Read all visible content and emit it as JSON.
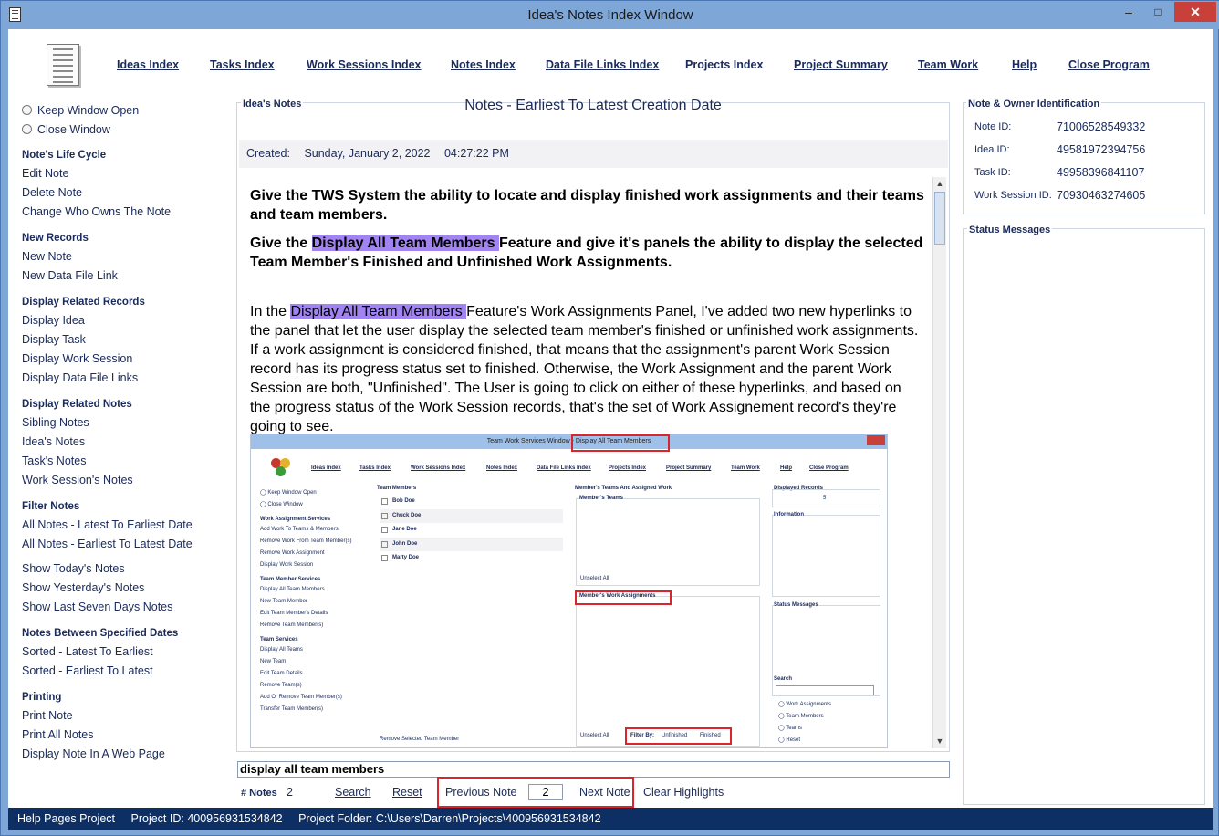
{
  "window": {
    "title": "Idea's Notes Index Window",
    "minimize": "–",
    "maximize": "□",
    "close": "✕"
  },
  "nav": [
    "Ideas Index",
    "Tasks Index",
    "Work Sessions Index",
    "Notes Index",
    "Data File Links Index",
    "Projects Index",
    "Project Summary",
    "Team Work",
    "Help",
    "Close Program"
  ],
  "left": {
    "radios": [
      "Keep Window Open",
      "Close Window"
    ],
    "sections": [
      {
        "title": "Note's Life Cycle",
        "items": [
          "Edit Note",
          "Delete Note",
          "Change Who Owns The Note"
        ]
      },
      {
        "title": "New Records",
        "items": [
          "New Note",
          "New Data File Link"
        ]
      },
      {
        "title": "Display Related Records",
        "items": [
          "Display Idea",
          "Display Task",
          "Display Work Session",
          "Display Data File Links"
        ]
      },
      {
        "title": "Display Related Notes",
        "items": [
          "Sibling Notes",
          "Idea's Notes",
          "Task's Notes",
          "Work Session's Notes"
        ]
      },
      {
        "title": "Filter Notes",
        "items": [
          "All Notes - Latest To Earliest Date",
          "All Notes - Earliest To Latest Date",
          "",
          "Show Today's Notes",
          "Show Yesterday's Notes",
          "Show Last Seven Days Notes"
        ]
      },
      {
        "title": "Notes Between Specified Dates",
        "items": [
          "Sorted - Latest To Earliest",
          "Sorted - Earliest To Latest"
        ]
      },
      {
        "title": "Printing",
        "items": [
          "Print Note",
          "Print All Notes",
          "Display Note In A Web Page"
        ]
      }
    ]
  },
  "notes": {
    "panel_title": "Idea's Notes",
    "heading": "Notes - Earliest To Latest Creation Date",
    "created_label": "Created:",
    "created_date": "Sunday, January 2, 2022",
    "created_time": "04:27:22 PM",
    "para1": "Give the TWS System the ability to locate and display finished work assignments and their teams and team members.",
    "para2_pre": "Give the ",
    "para2_hl": "Display All Team Members ",
    "para2_post": "Feature and give it's panels the ability to display the selected Team Member's Finished and Unfinished Work Assignments.",
    "para3_pre": "In the ",
    "para3_hl": "Display All Team Members ",
    "para3_post": "Feature's Work Assignments Panel, I've added two new hyperlinks to the panel that let the user display the selected team member's finished or unfinished work assignments. If a work assignment is considered finished, that means that the assignment's parent Work Session record has its progress status set to finished. Otherwise, the Work Assignment and the parent Work Session are both, \"Unfinished\". The User is going to click on either of these hyperlinks, and based on the progress status of the Work Session records, that's the set of Work Assignement record's they're going to see."
  },
  "embedded": {
    "title_pre": "Team Work Services Window",
    "title_hl": "Display All Team Members",
    "nav": [
      "Ideas Index",
      "Tasks Index",
      "Work Sessions Index",
      "Notes Index",
      "Data File Links Index",
      "Projects Index",
      "Project Summary",
      "Team Work",
      "Help",
      "Close Program"
    ],
    "radios": [
      "Keep Window Open",
      "Close Window"
    ],
    "sections": [
      {
        "title": "Work Assignment Services",
        "items": [
          "Add Work To Teams & Members",
          "Remove Work From Team Member(s)",
          "Remove Work Assignment",
          "Display Work Session"
        ]
      },
      {
        "title": "Team Member Services",
        "items": [
          "Display All Team Members",
          "New Team Member",
          "Edit Team Member's Details",
          "Remove Team Member(s)"
        ]
      },
      {
        "title": "Team Services",
        "items": [
          "Display All Teams",
          "New Team",
          "Edit Team Details",
          "Remove Team(s)",
          "Add Or Remove Team Member(s)",
          "Transfer Team Member(s)"
        ]
      }
    ],
    "team_members_label": "Team Members",
    "members": [
      "Bob Doe",
      "Chuck Doe",
      "Jane Doe",
      "John Doe",
      "Marty Doe"
    ],
    "remove_selected": "Remove Selected Team Member",
    "assigned_label": "Member's Teams And Assigned Work",
    "members_teams": "Member's Teams",
    "unselect_all": "Unselect All",
    "work_assignments": "Member's Work Assignments",
    "filter_by": "Filter By:",
    "unfinished": "Unfinished",
    "finished": "Finished",
    "displayed_records": "Displayed Records",
    "displayed_count": "5",
    "information": "Information",
    "status_messages": "Status Messages",
    "search": "Search",
    "search_opts": [
      "Work Assignments",
      "Team Members",
      "Teams",
      "Reset"
    ]
  },
  "search": {
    "value": "display all team members"
  },
  "bottom": {
    "count_label": "# Notes",
    "count": "2",
    "search": "Search",
    "reset": "Reset",
    "prev": "Previous Note",
    "current": "2",
    "next": "Next Note",
    "clear": "Clear Highlights"
  },
  "ident": {
    "title": "Note & Owner Identification",
    "rows": [
      {
        "label": "Note ID:",
        "value": "71006528549332"
      },
      {
        "label": "Idea ID:",
        "value": "49581972394756"
      },
      {
        "label": "Task ID:",
        "value": "49958396841107"
      },
      {
        "label": "Work Session ID:",
        "value": "70930463274605"
      }
    ]
  },
  "status": {
    "title": "Status Messages"
  },
  "statusbar": {
    "project": "Help Pages Project",
    "project_id": "Project ID:  400956931534842",
    "folder": "Project Folder:  C:\\Users\\Darren\\Projects\\400956931534842"
  },
  "colors": {
    "highlight": "#a184f1",
    "status_bar": "#0e2f63",
    "red_box": "#d9262c",
    "title_bar": "#7ea7d8"
  }
}
